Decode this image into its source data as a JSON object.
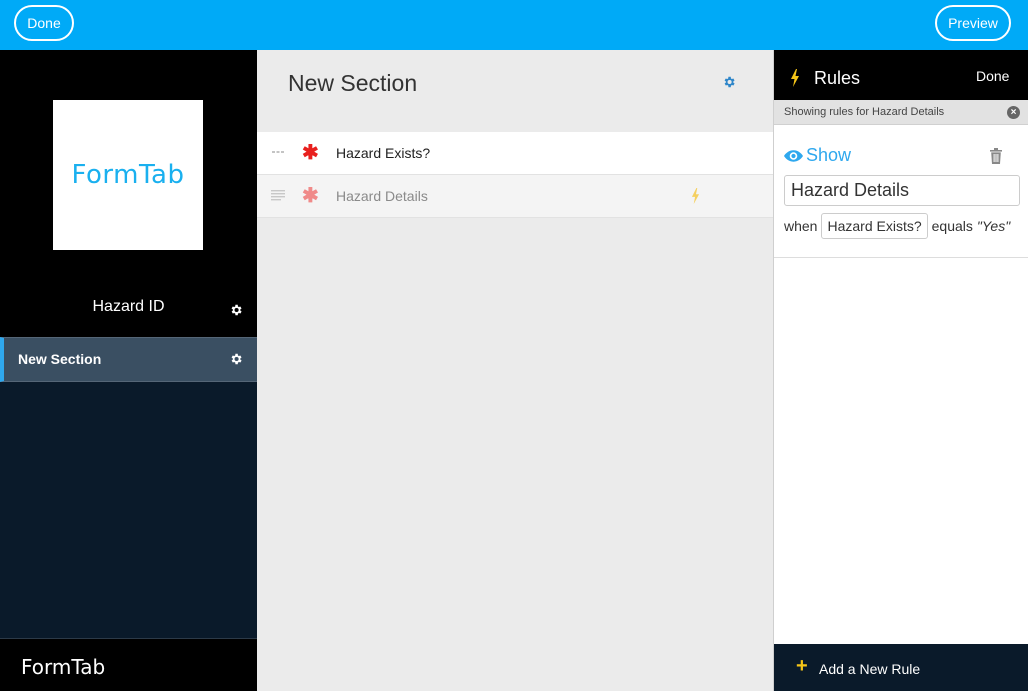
{
  "topbar": {
    "done_label": "Done",
    "preview_label": "Preview"
  },
  "sidebar": {
    "logo_text": "FormTab",
    "form_name": "Hazard ID",
    "sections": [
      {
        "label": "New Section",
        "active": true
      }
    ],
    "footer_text": "FormTab"
  },
  "main": {
    "section_title": "New Section",
    "fields": [
      {
        "label": "Hazard Exists?",
        "required": true,
        "has_rule": false
      },
      {
        "label": "Hazard Details",
        "required": true,
        "has_rule": true
      }
    ]
  },
  "rules": {
    "title": "Rules",
    "done_label": "Done",
    "showing_text": "Showing rules for Hazard Details",
    "rule": {
      "action": "Show",
      "target": "Hazard Details",
      "when_label": "when",
      "condition_field": "Hazard Exists?",
      "operator": "equals",
      "value": "\"Yes\""
    },
    "add_rule_label": "Add a New Rule"
  },
  "colors": {
    "accent_blue": "#00aaf7",
    "required_red": "#e8201e",
    "rule_bolt_yellow": "#f5c518",
    "sidebar_dark": "#0a1a2a"
  },
  "icons": [
    "gear-icon",
    "drag-handle-icon",
    "required-asterisk-icon",
    "bolt-icon",
    "eye-icon",
    "trash-icon",
    "close-icon",
    "plus-icon"
  ]
}
